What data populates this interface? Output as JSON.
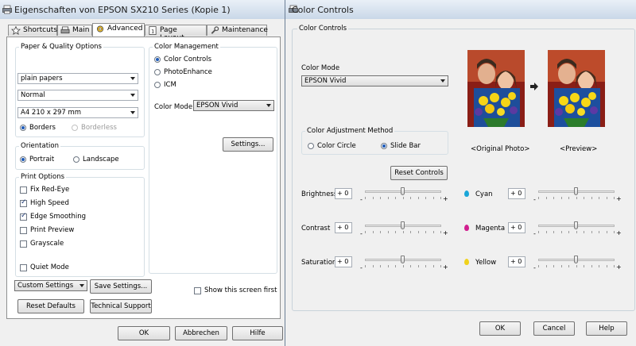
{
  "left_window": {
    "title": "Eigenschaften von EPSON SX210 Series (Kopie 1)",
    "tabs": [
      {
        "label": "Shortcuts",
        "icon": "star-icon"
      },
      {
        "label": "Main",
        "icon": "printer-icon"
      },
      {
        "label": "Advanced",
        "icon": "gear-icon"
      },
      {
        "label": "Page Layout",
        "icon": "page-icon"
      },
      {
        "label": "Maintenance",
        "icon": "wrench-icon"
      }
    ],
    "paper_quality": {
      "label": "Paper & Quality Options",
      "paper_type": "plain papers",
      "quality": "Normal",
      "size": "A4 210 x 297 mm",
      "borders": "Borders",
      "borderless": "Borderless"
    },
    "orientation": {
      "label": "Orientation",
      "portrait": "Portrait",
      "landscape": "Landscape"
    },
    "print_options": {
      "label": "Print Options",
      "items": [
        {
          "label": "Fix Red-Eye",
          "checked": false
        },
        {
          "label": "High Speed",
          "checked": true
        },
        {
          "label": "Edge Smoothing",
          "checked": true
        },
        {
          "label": "Print Preview",
          "checked": false
        },
        {
          "label": "Grayscale",
          "checked": false
        }
      ],
      "quiet_mode": "Quiet Mode"
    },
    "color_management": {
      "label": "Color Management",
      "color_controls": "Color Controls",
      "photo_enhance": "PhotoEnhance",
      "icm": "ICM",
      "color_mode_label": "Color Mode",
      "color_mode_value": "EPSON Vivid",
      "settings_button": "Settings..."
    },
    "custom_settings": "Custom Settings",
    "save_settings": "Save Settings...",
    "show_first": "Show this screen first",
    "reset_defaults": "Reset Defaults",
    "technical_support": "Technical Support",
    "ok": "OK",
    "cancel": "Abbrechen",
    "help": "Hilfe"
  },
  "right_window": {
    "title": "Color Controls",
    "group_label": "Color Controls",
    "color_mode_label": "Color Mode",
    "color_mode_value": "EPSON Vivid",
    "adjustment_label": "Color Adjustment Method",
    "color_circle": "Color Circle",
    "slide_bar": "Slide Bar",
    "original_caption": "<Original Photo>",
    "preview_caption": "<Preview>",
    "reset_controls": "Reset Controls",
    "sliders": [
      {
        "label": "Brightness",
        "value": "+ 0",
        "level": 0.5
      },
      {
        "label": "Contrast",
        "value": "+ 0",
        "level": 0.5
      },
      {
        "label": "Saturation",
        "value": "+ 0",
        "level": 0.5
      },
      {
        "label": "Cyan",
        "value": "+ 0",
        "level": 0.5,
        "color": "#19a6d8"
      },
      {
        "label": "Magenta",
        "value": "+ 0",
        "level": 0.5,
        "color": "#d11f8f"
      },
      {
        "label": "Yellow",
        "value": "+ 0",
        "level": 0.5,
        "color": "#f0d21c"
      }
    ],
    "minus": "-",
    "plus": "+",
    "ok": "OK",
    "cancel": "Cancel",
    "help": "Help"
  }
}
